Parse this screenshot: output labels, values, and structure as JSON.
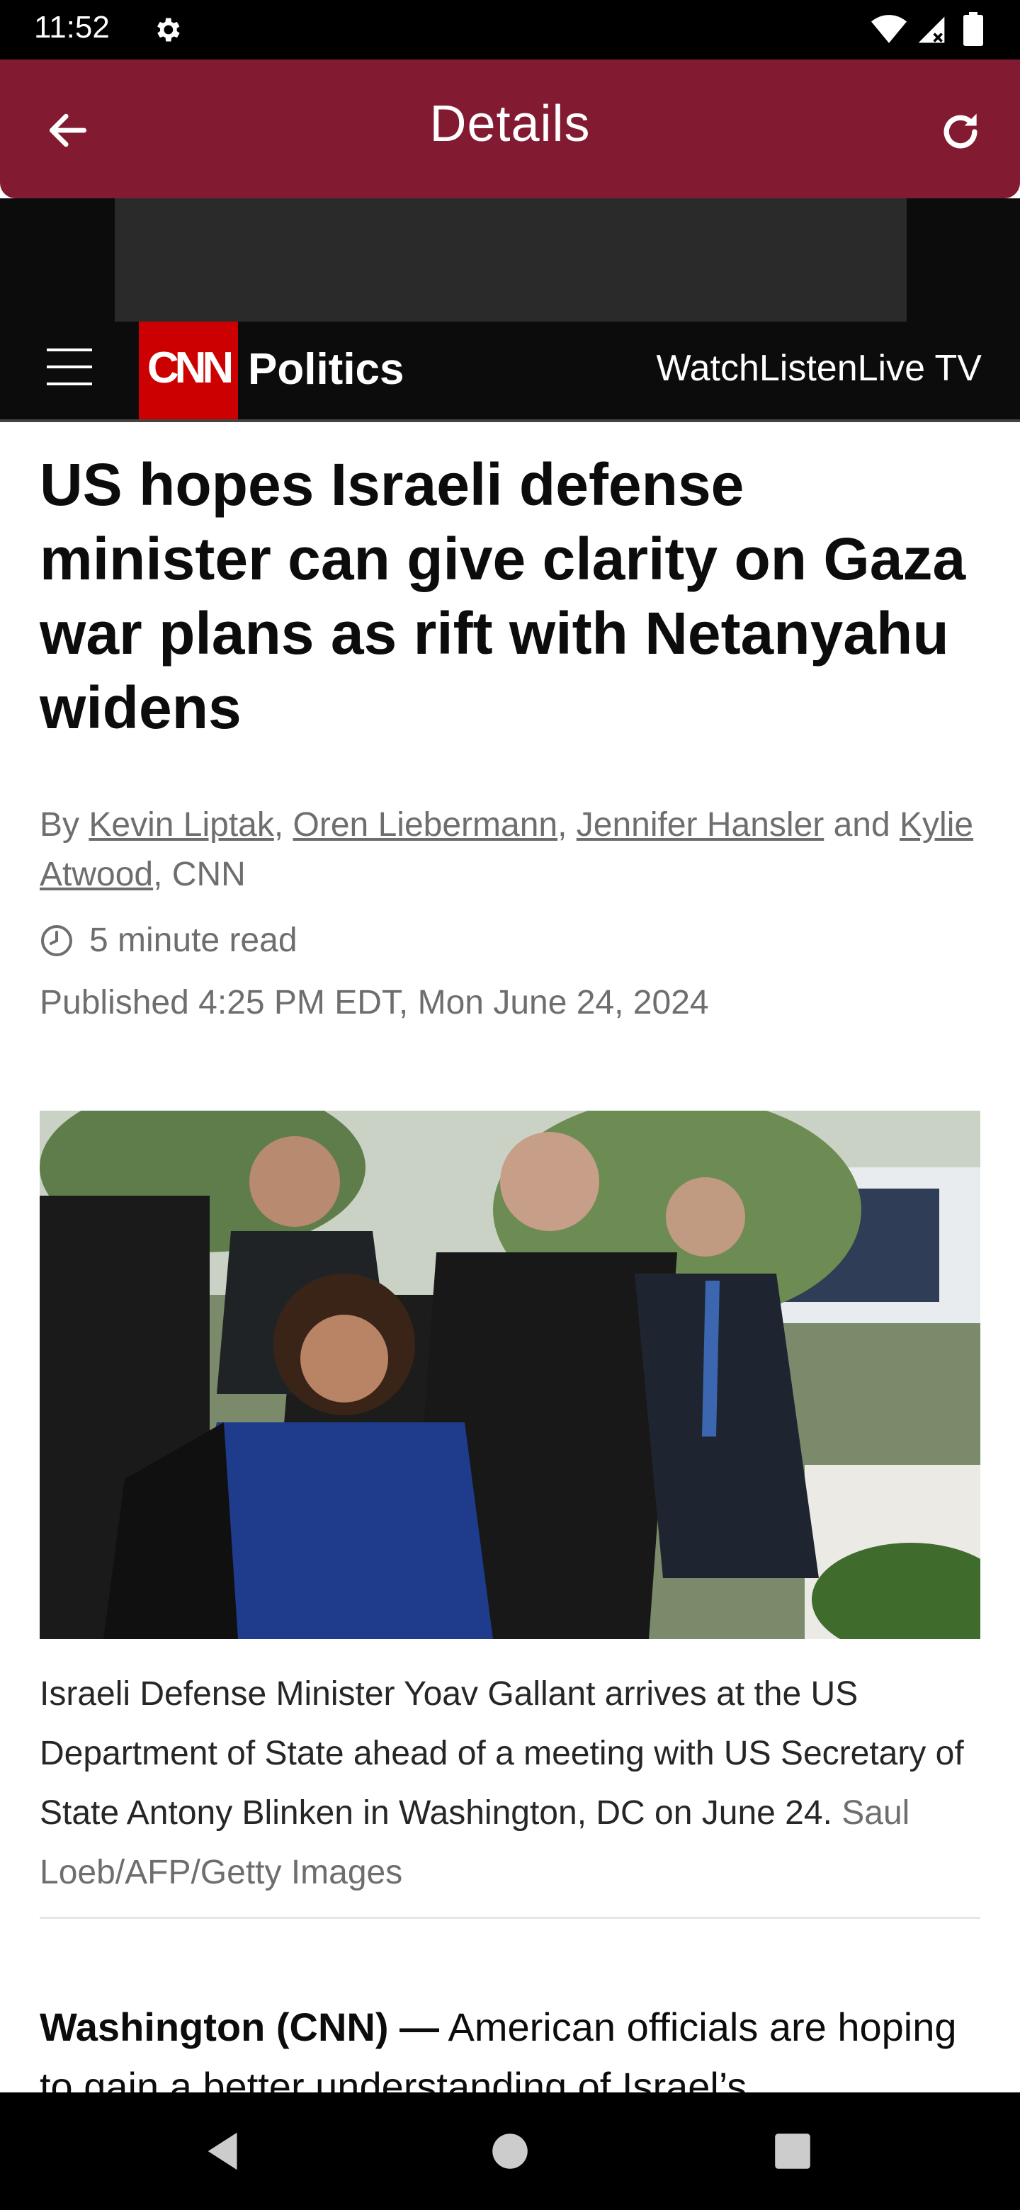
{
  "status_bar": {
    "time": "11:52"
  },
  "app_bar": {
    "title": "Details"
  },
  "site_nav": {
    "logo_text": "CNN",
    "section": "Politics",
    "links": [
      "Watch",
      "Listen",
      "Live TV"
    ]
  },
  "article": {
    "headline": "US hopes Israeli defense minister can give clarity on Gaza war plans as rift with Netanyahu widens",
    "byline": {
      "prefix": "By ",
      "authors": [
        "Kevin Liptak",
        "Oren Liebermann",
        "Jennifer Hansler",
        "Kylie Atwood"
      ],
      "sep1": ", ",
      "sep2": ", ",
      "and": " and ",
      "suffix": ", CNN"
    },
    "read_time": "5 minute read",
    "published": "Published 4:25 PM EDT, Mon June 24, 2024",
    "caption": "Israeli Defense Minister Yoav Gallant arrives at the US Department of State ahead of a meeting with US Secretary of State Antony Blinken in Washington, DC on June 24.",
    "photo_credit": "Saul Loeb/AFP/Getty Images",
    "lede_dateline": "Washington (CNN) —",
    "lede_text": " American officials are hoping to gain a better understanding of Israel’s"
  },
  "colors": {
    "app_bar": "#821a31",
    "cnn_red": "#cc0000",
    "site_header": "#0c0c0c"
  }
}
